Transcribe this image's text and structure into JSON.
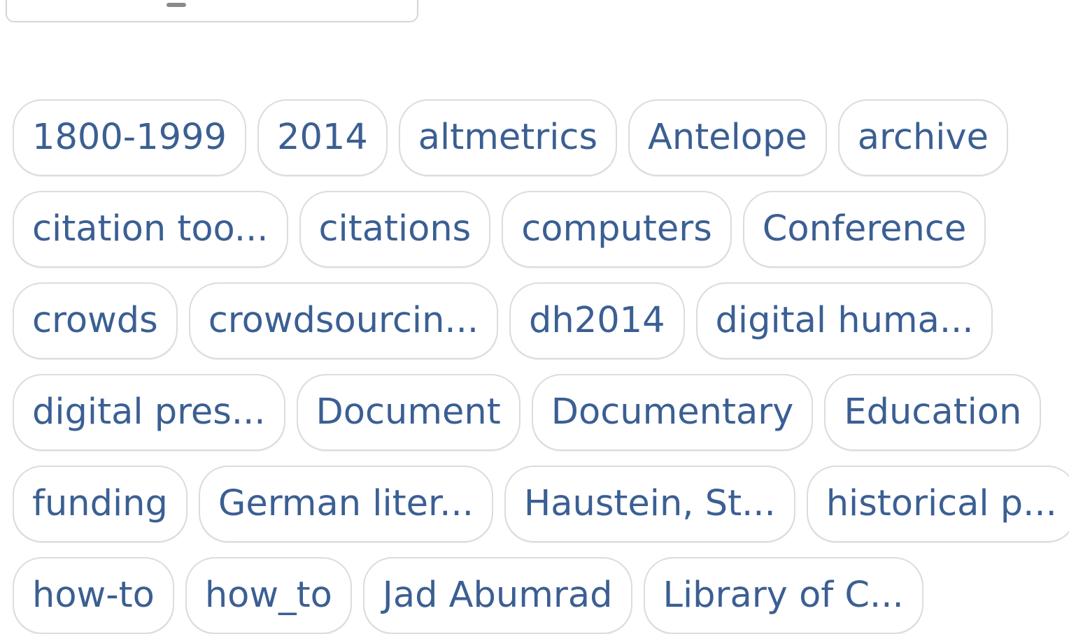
{
  "tag_rows": [
    [
      "1800-1999",
      "2014",
      "altmetrics",
      "Antelope",
      "archive"
    ],
    [
      "citation too...",
      "citations",
      "computers",
      "Conference"
    ],
    [
      "crowds",
      "crowdsourcin...",
      "dh2014",
      "digital huma..."
    ],
    [
      "digital pres...",
      "Document",
      "Documentary",
      "Education"
    ],
    [
      "funding",
      "German liter...",
      "Haustein, St...",
      "historical p..."
    ],
    [
      "how-to",
      "how_to",
      "Jad Abumrad",
      "Library of C..."
    ]
  ],
  "colors": {
    "tag_text": "#3b5f93",
    "tag_border": "#dcdcdc",
    "background": "#ffffff"
  }
}
